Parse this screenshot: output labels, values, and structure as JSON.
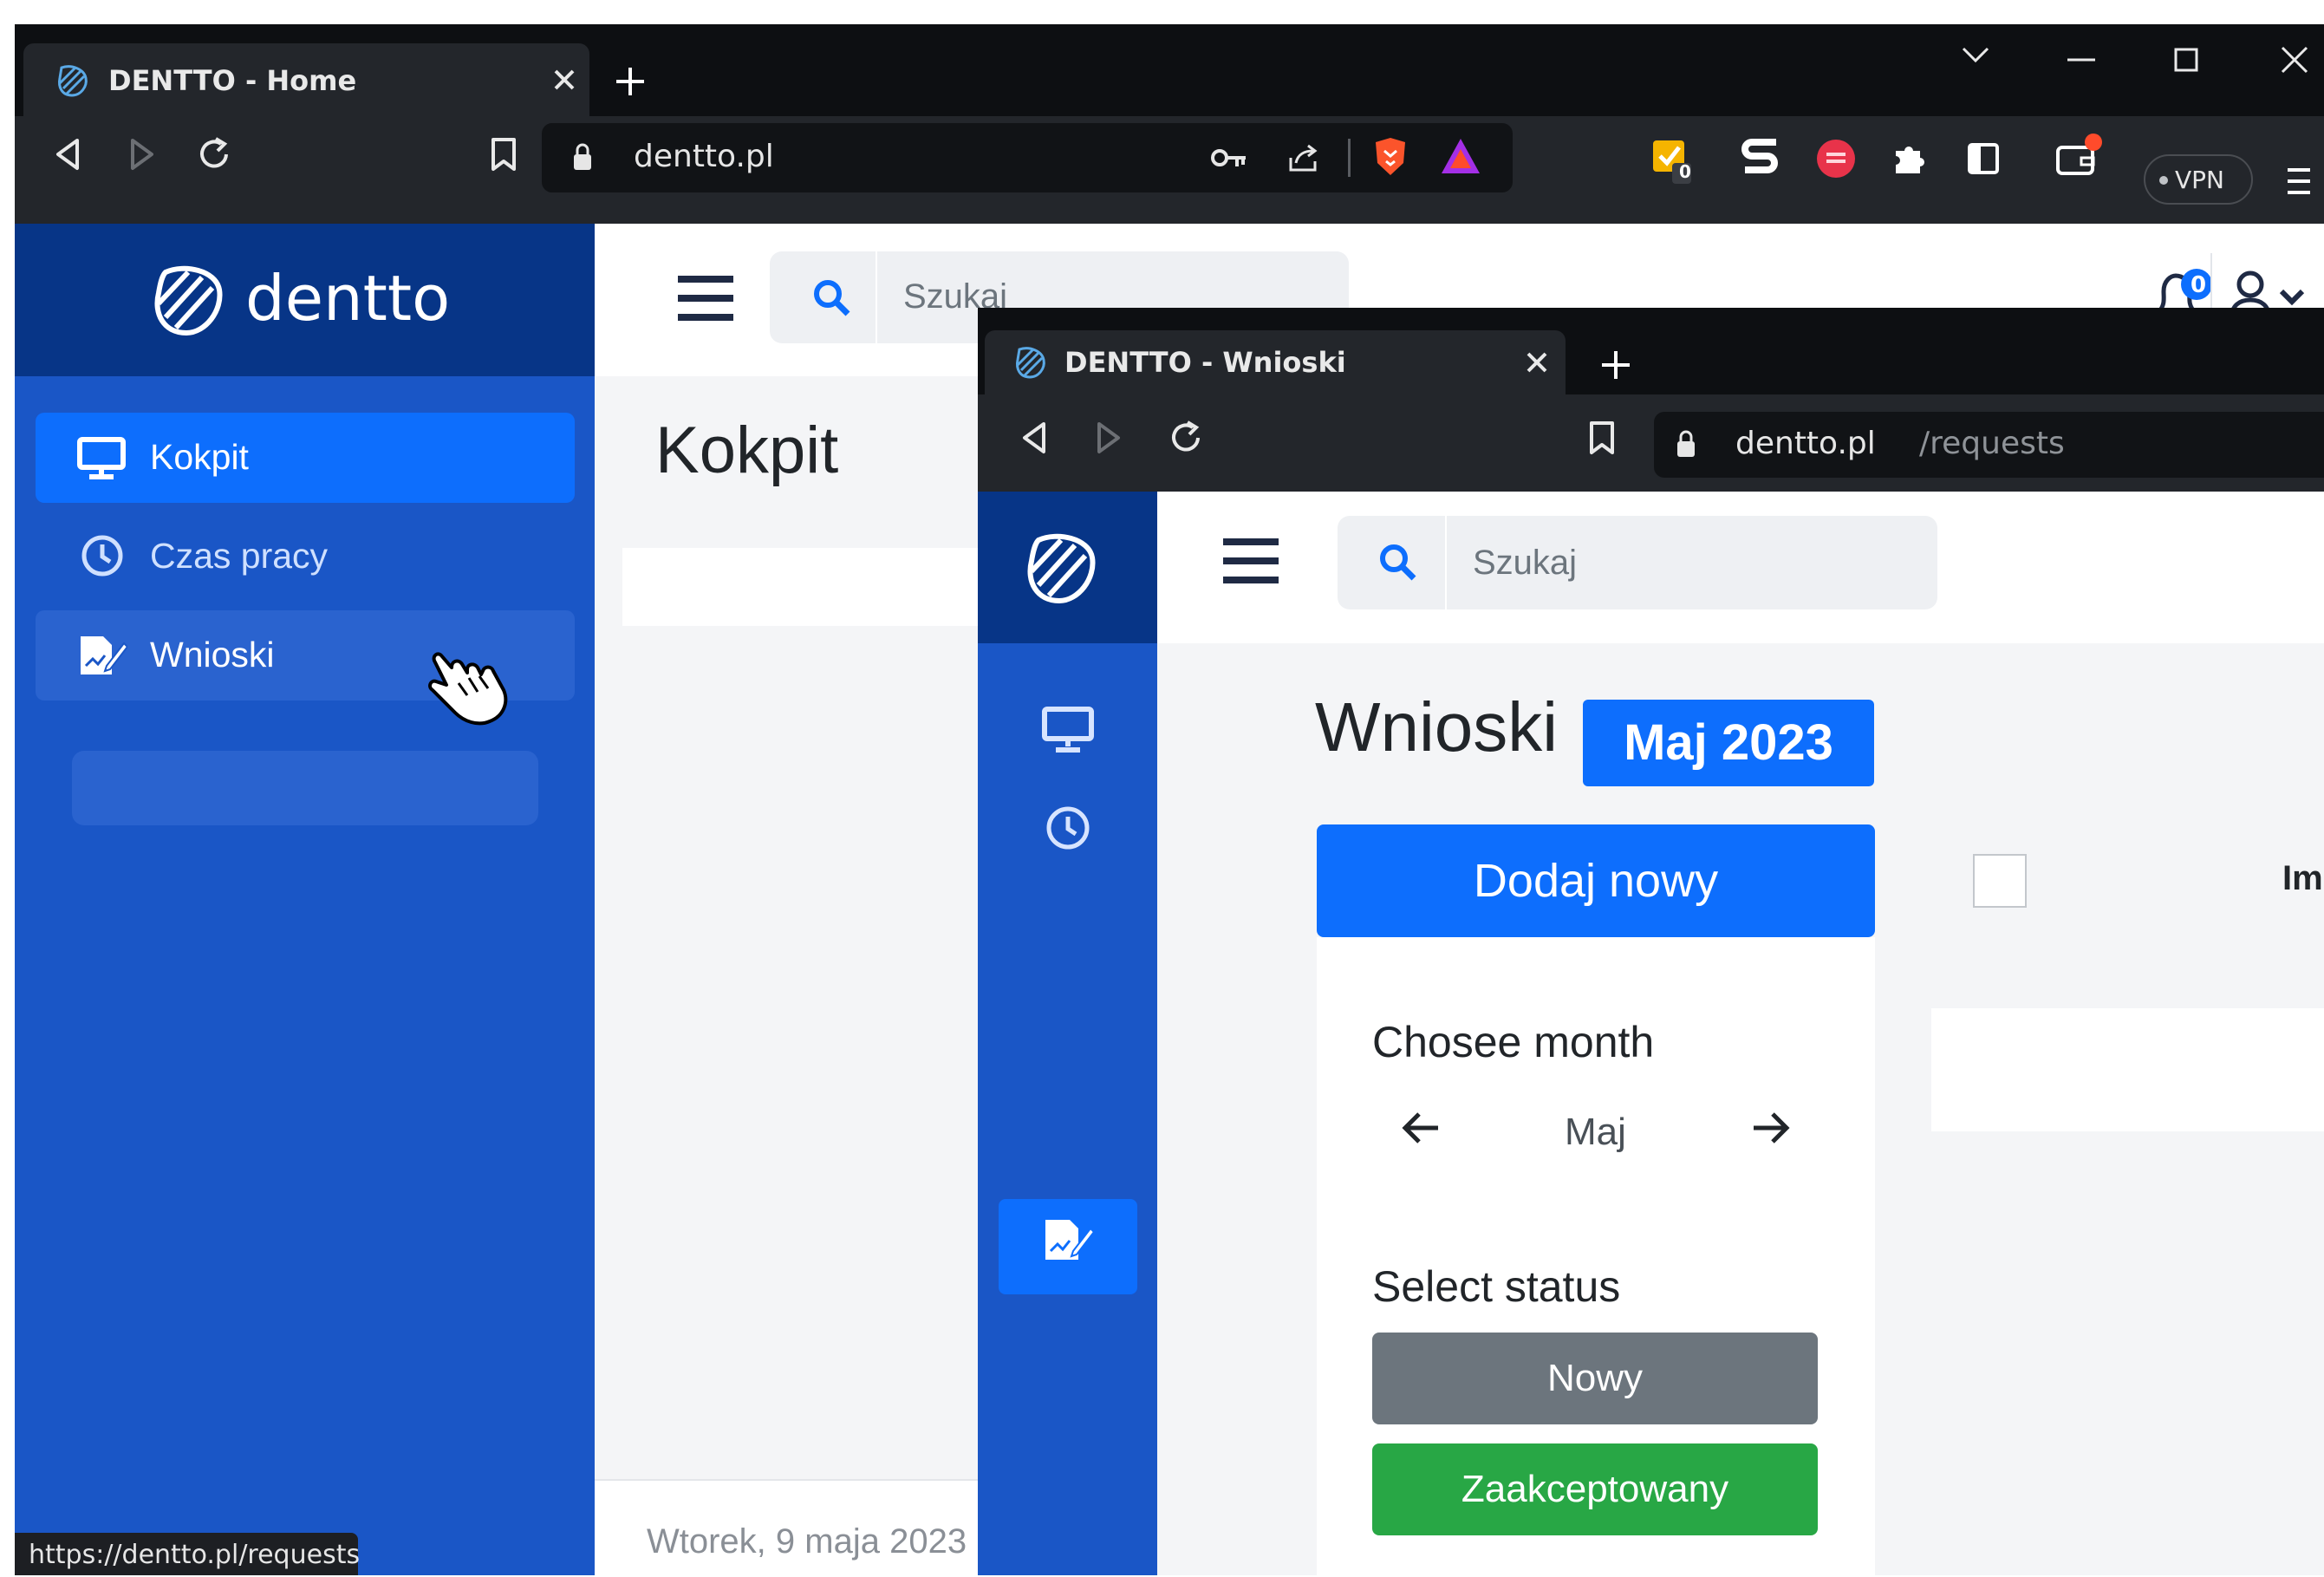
{
  "window1": {
    "tab_title": "DENTTO - Home",
    "url": "dentto.pl",
    "vpn_label": "VPN",
    "extension_badge": "0"
  },
  "app1": {
    "brand": "dentto",
    "nav": {
      "kokpit": "Kokpit",
      "czas_pracy": "Czas pracy",
      "wnioski": "Wnioski"
    },
    "search_placeholder": "Szukaj",
    "notification_count": "0",
    "page_title": "Kokpit",
    "footer_date": "Wtorek, 9 maja 2023"
  },
  "status_url": "https://dentto.pl/requests",
  "window2": {
    "tab_title": "DENTTO - Wnioski",
    "url_host": "dentto.pl",
    "url_path": "/requests"
  },
  "app2": {
    "search_placeholder": "Szukaj",
    "page_title": "Wnioski",
    "month_badge": "Maj 2023",
    "add_button": "Dodaj nowy",
    "month_heading": "Chosee month",
    "current_month": "Maj",
    "status_heading": "Select status",
    "status_new": "Nowy",
    "status_accepted": "Zaakceptowany",
    "table_header_name": "Imię i"
  },
  "colors": {
    "sidebar_blue": "#1a56c6",
    "brand_navy": "#073587",
    "primary": "#0d6efd",
    "secondary": "#6c757d",
    "success": "#28a745"
  }
}
